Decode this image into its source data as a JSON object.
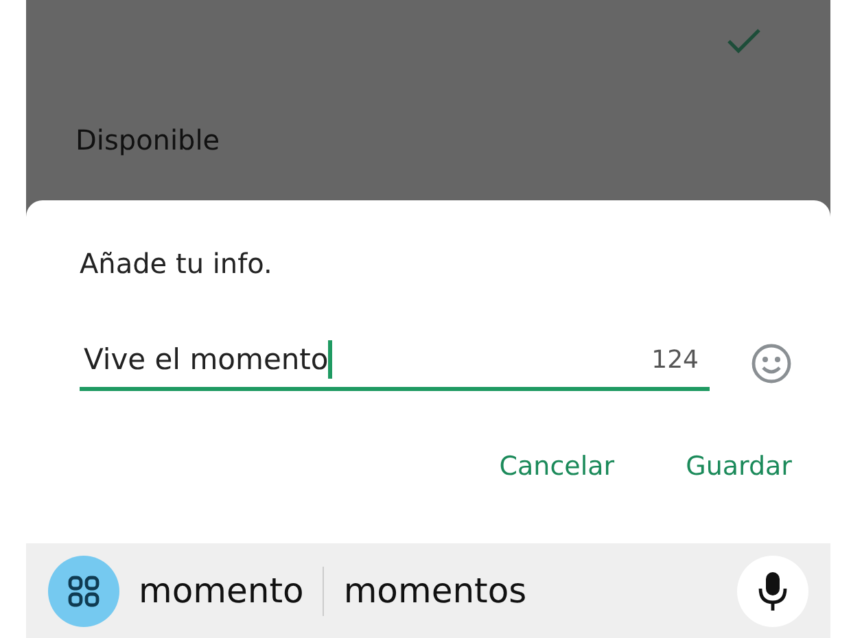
{
  "background_list": [
    {
      "checked": true
    },
    {
      "label": "Disponible",
      "checked": false
    }
  ],
  "dialog": {
    "title": "Añade tu info.",
    "field": {
      "value": "Vive el momento",
      "counter": "124"
    },
    "buttons": [
      "Cancelar",
      "Guardar"
    ]
  },
  "keyboard": {
    "suggestions": [
      "momento",
      "momentos"
    ]
  }
}
